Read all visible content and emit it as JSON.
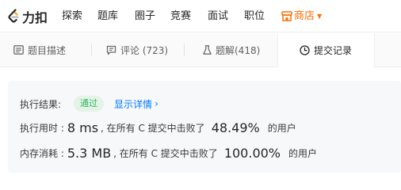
{
  "brand": {
    "name": "力扣"
  },
  "nav": {
    "items": [
      "探索",
      "题库",
      "圈子",
      "竞赛",
      "面试",
      "职位"
    ],
    "store_label": "商店"
  },
  "tabs": [
    {
      "label": "题目描述",
      "icon": "document-icon"
    },
    {
      "label": "评论 (723)",
      "icon": "comment-icon"
    },
    {
      "label": "题解(418)",
      "icon": "flask-icon"
    },
    {
      "label": "提交记录",
      "icon": "clock-icon"
    }
  ],
  "active_tab": "提交记录",
  "result": {
    "status_label": "执行结果:",
    "status_value": "通过",
    "detail_link": "显示详情",
    "time_label": "执行用时 :",
    "time_value": "8 ms",
    "time_mid": ", 在所有 C 提交中击败了",
    "time_percent": "48.49%",
    "time_tail": "的用户",
    "memory_label": "内存消耗 :",
    "memory_value": "5.3 MB",
    "memory_mid": ", 在所有 C 提交中击败了",
    "memory_percent": "100.00%",
    "memory_tail": "的用户"
  },
  "colors": {
    "accent_orange": "#ff6d00",
    "success_green": "#2db55d",
    "link_blue": "#007aff"
  }
}
